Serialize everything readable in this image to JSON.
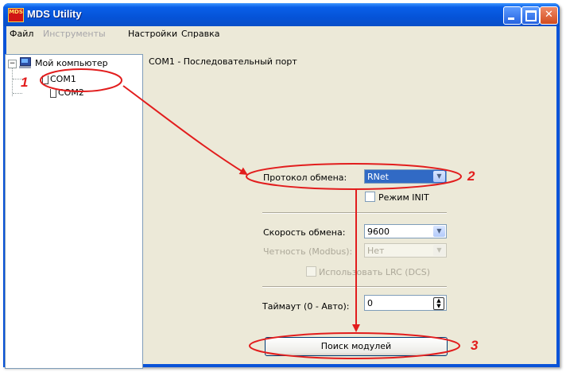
{
  "window": {
    "title": "MDS Utility",
    "icon_text": "MDS",
    "controls": [
      "minimize-icon",
      "maximize-icon",
      "close-icon"
    ]
  },
  "menu": [
    {
      "label": "Файл",
      "enabled": true
    },
    {
      "label": "Инструменты",
      "enabled": false
    },
    {
      "label": "Настройки",
      "enabled": true
    },
    {
      "label": "Справка",
      "enabled": true
    }
  ],
  "tree": {
    "root_label": "Мой компьютер",
    "expander": "⊟",
    "items": [
      {
        "label": "COM1"
      },
      {
        "label": "COM2"
      }
    ]
  },
  "panel": {
    "header": "COM1 - Последовательный порт",
    "protocol_label": "Протокол обмена:",
    "protocol_value": "RNet",
    "init_mode_label": "Режим INIT",
    "speed_label": "Скорость обмена:",
    "speed_value": "9600",
    "parity_label": "Четность (Modbus):",
    "parity_value": "Нет",
    "lrc_label": "Использовать LRC (DCS)",
    "timeout_label": "Таймаут (0 - Авто):",
    "timeout_value": "0",
    "search_button": "Поиск модулей"
  },
  "annotations": {
    "n1": "1",
    "n2": "2",
    "n3": "3",
    "color": "#e21d1d"
  }
}
